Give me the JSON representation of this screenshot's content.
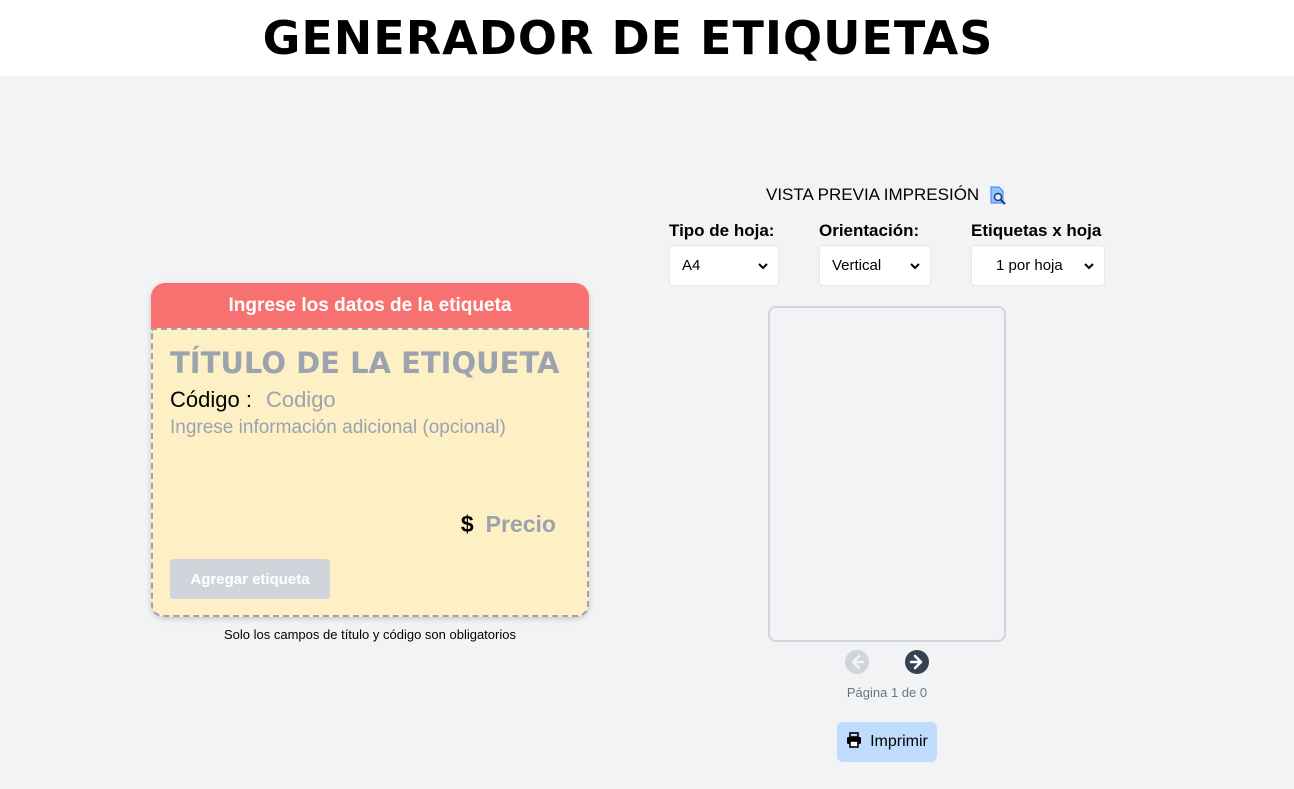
{
  "header": {
    "title": "GENERADOR DE ETIQUETAS"
  },
  "form": {
    "heading": "Ingrese los datos de la etiqueta",
    "title_placeholder": "TÍTULO DE LA ETIQUETA",
    "code_label": "Código :",
    "code_placeholder": "Codigo",
    "info_placeholder": "Ingrese información adicional (opcional)",
    "price_symbol": "$",
    "price_placeholder": "Precio",
    "add_button": "Agregar etiqueta",
    "note": "Solo los campos de título y código son obligatorios"
  },
  "preview": {
    "title": "VISTA PREVIA IMPRESIÓN",
    "icon": "print-preview-icon",
    "sheet_type": {
      "label": "Tipo de hoja:",
      "value": "A4"
    },
    "orientation": {
      "label": "Orientación:",
      "value": "Vertical"
    },
    "per_sheet": {
      "label": "Etiquetas x hoja",
      "value": "1 por hoja"
    },
    "page_info": "Página 1 de 0",
    "print_button": "Imprimir"
  },
  "colors": {
    "header_red": "#f87171",
    "card_bg": "#fdf0c5",
    "print_btn": "#bfdbfe"
  }
}
